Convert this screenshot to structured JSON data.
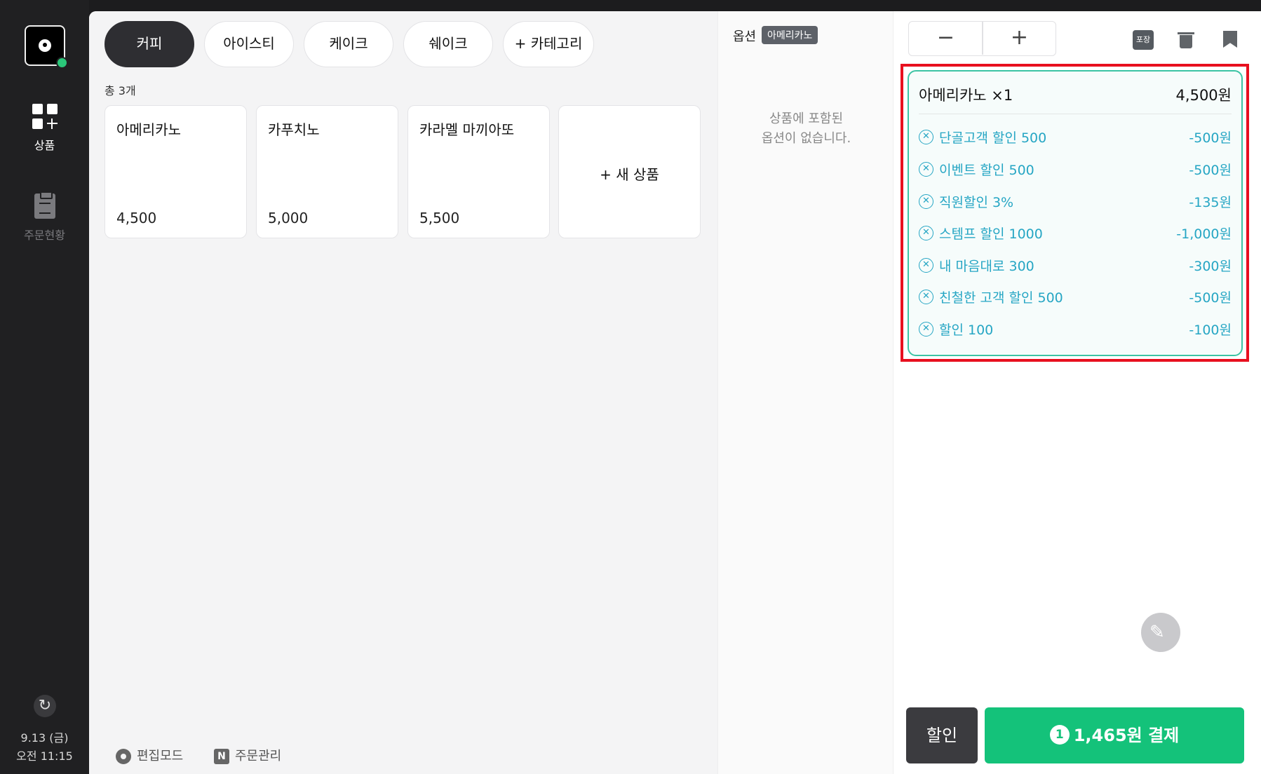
{
  "sidebar": {
    "nav": [
      {
        "label": "상품",
        "icon": "grid-plus-icon"
      },
      {
        "label": "주문현황",
        "icon": "clipboard-icon"
      }
    ],
    "date": "9.13 (금)",
    "time": "오전 11:15"
  },
  "categories": [
    "커피",
    "아이스티",
    "케이크",
    "쉐이크",
    "+ 카테고리"
  ],
  "product_count": "총 3개",
  "products": [
    {
      "name": "아메리카노",
      "price": "4,500"
    },
    {
      "name": "카푸치노",
      "price": "5,000"
    },
    {
      "name": "카라멜 마끼아또",
      "price": "5,500"
    }
  ],
  "new_product": "+ 새 상품",
  "footer": {
    "edit_mode": "편집모드",
    "order_manage": "주문관리"
  },
  "options": {
    "title": "옵션",
    "tag": "아메리카노",
    "empty_line1": "상품에 포함된",
    "empty_line2": "옵션이 없습니다."
  },
  "toolbar": {
    "minus": "−",
    "plus": "+",
    "pack_label": "포장"
  },
  "order": {
    "item": "아메리카노 ×1",
    "price": "4,500원",
    "discounts": [
      {
        "name": "단골고객 할인 500",
        "amount": "-500원"
      },
      {
        "name": "이벤트 할인 500",
        "amount": "-500원"
      },
      {
        "name": "직원할인 3%",
        "amount": "-135원"
      },
      {
        "name": "스템프 할인 1000",
        "amount": "-1,000원"
      },
      {
        "name": "내 마음대로 300",
        "amount": "-300원"
      },
      {
        "name": "친철한 고객 할인 500",
        "amount": "-500원"
      },
      {
        "name": "할인 100",
        "amount": "-100원"
      }
    ]
  },
  "actions": {
    "discount": "할인",
    "pay_count": "1",
    "pay": "1,465원 결제"
  },
  "colors": {
    "accent": "#14c27a",
    "discount_text": "#26a6c4",
    "highlight": "#e8101f"
  }
}
